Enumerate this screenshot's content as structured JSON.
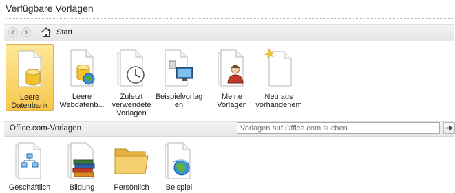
{
  "header": {
    "title": "Verfügbare Vorlagen"
  },
  "nav": {
    "location": "Start"
  },
  "templates": [
    {
      "label": "Leere Datenbank",
      "icon": "blank-database-icon",
      "selected": true
    },
    {
      "label": "Leere Webdatenb...",
      "icon": "blank-web-database-icon",
      "selected": false
    },
    {
      "label": "Zuletzt verwendete Vorlagen",
      "icon": "recent-templates-icon",
      "selected": false
    },
    {
      "label": "Beispielvorlagen",
      "label_display": "Beispielvorlag en",
      "icon": "sample-templates-icon",
      "selected": false
    },
    {
      "label": "Meine Vorlagen",
      "icon": "my-templates-icon",
      "selected": false
    },
    {
      "label": "Neu aus vorhandenem",
      "icon": "new-from-existing-icon",
      "selected": false
    }
  ],
  "office_section": {
    "label": "Office.com-Vorlagen",
    "search_placeholder": "Vorlagen auf Office.com suchen",
    "categories": [
      {
        "label": "Geschäftlich",
        "icon": "business-icon"
      },
      {
        "label": "Bildung",
        "icon": "education-books-icon"
      },
      {
        "label": "Persönlich",
        "icon": "personal-folder-icon"
      },
      {
        "label": "Beispiel",
        "icon": "sample-globe-icon"
      }
    ]
  },
  "colors": {
    "selected_top": "#fde89a",
    "selected_bottom": "#f8c74d",
    "accent_blue": "#2a6fb5"
  }
}
